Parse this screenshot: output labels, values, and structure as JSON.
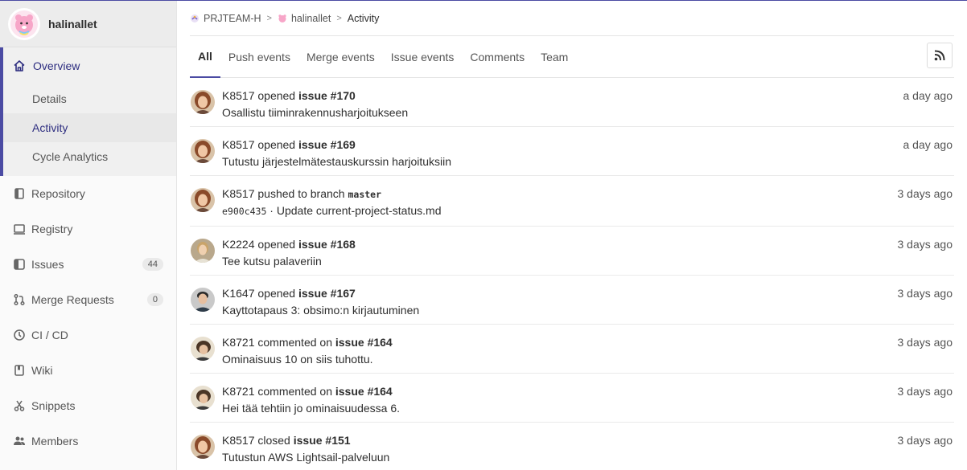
{
  "project": {
    "name": "halinallet"
  },
  "sidebar": {
    "overview": {
      "label": "Overview",
      "subs": [
        {
          "label": "Details"
        },
        {
          "label": "Activity"
        },
        {
          "label": "Cycle Analytics"
        }
      ]
    },
    "items": [
      {
        "label": "Repository",
        "icon": "book-icon"
      },
      {
        "label": "Registry",
        "icon": "container-icon"
      },
      {
        "label": "Issues",
        "icon": "issues-icon",
        "count": "44"
      },
      {
        "label": "Merge Requests",
        "icon": "merge-request-icon",
        "count": "0"
      },
      {
        "label": "CI / CD",
        "icon": "rocket-icon"
      },
      {
        "label": "Wiki",
        "icon": "book-closed-icon"
      },
      {
        "label": "Snippets",
        "icon": "scissors-icon"
      },
      {
        "label": "Members",
        "icon": "users-icon"
      }
    ]
  },
  "breadcrumb": {
    "group": "PRJTEAM-H",
    "project": "halinallet",
    "page": "Activity"
  },
  "tabs": [
    {
      "label": "All"
    },
    {
      "label": "Push events"
    },
    {
      "label": "Merge events"
    },
    {
      "label": "Issue events"
    },
    {
      "label": "Comments"
    },
    {
      "label": "Team"
    }
  ],
  "events": [
    {
      "author": "K8517",
      "action": "opened",
      "target": "issue #170",
      "detail": "Osallistu tiiminrakennusharjoitukseen",
      "time": "a day ago"
    },
    {
      "author": "K8517",
      "action": "opened",
      "target": "issue #169",
      "detail": "Tutustu järjestelmätestauskurssin harjoituksiin",
      "time": "a day ago"
    },
    {
      "author": "K8517",
      "action": "pushed to branch",
      "target": "master",
      "commit": "e900c435",
      "detail": "Update current-project-status.md",
      "time": "3 days ago"
    },
    {
      "author": "K2224",
      "action": "opened",
      "target": "issue #168",
      "detail": "Tee kutsu palaveriin",
      "time": "3 days ago"
    },
    {
      "author": "K1647",
      "action": "opened",
      "target": "issue #167",
      "detail": "Kayttotapaus 3: obsimo:n kirjautuminen",
      "time": "3 days ago"
    },
    {
      "author": "K8721",
      "action": "commented on",
      "target": "issue #164",
      "detail": "Ominaisuus 10 on siis tuhottu.",
      "time": "3 days ago"
    },
    {
      "author": "K8721",
      "action": "commented on",
      "target": "issue #164",
      "detail": "Hei tää tehtiin jo ominaisuudessa 6.",
      "time": "3 days ago"
    },
    {
      "author": "K8517",
      "action": "closed",
      "target": "issue #151",
      "detail": "Tutustun AWS Lightsail-palveluun",
      "time": "3 days ago"
    }
  ]
}
